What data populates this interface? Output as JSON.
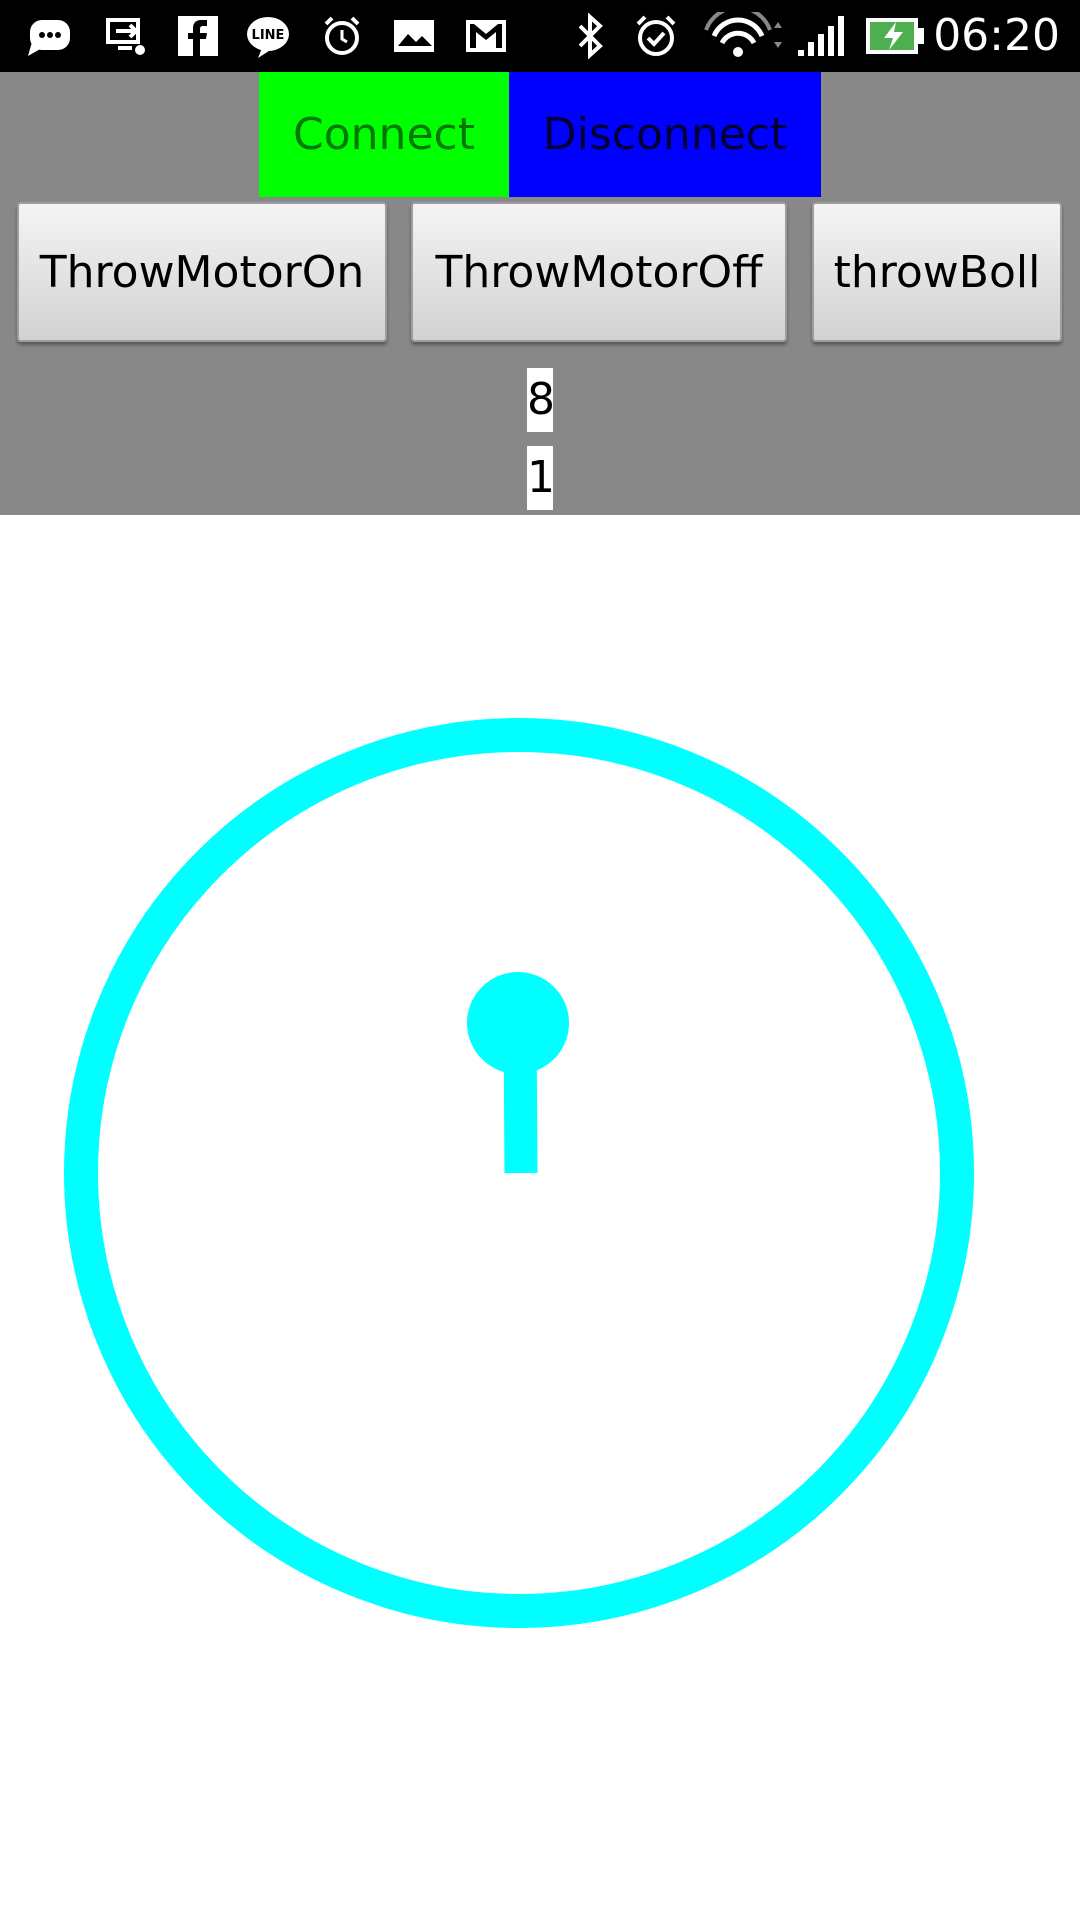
{
  "status_bar": {
    "time": "06:20",
    "icons": [
      "chat-bubble-icon",
      "screen-cast-icon",
      "facebook-icon",
      "line-icon",
      "alarm-clock-icon",
      "photo-icon",
      "gmail-icon",
      "bluetooth-icon",
      "alarm-check-icon",
      "wifi-icon",
      "signal-icon",
      "battery-charging-icon"
    ],
    "background": "#000000"
  },
  "controls": {
    "connect_label": "Connect",
    "disconnect_label": "Disconnect",
    "connect_color": "#00ff00",
    "disconnect_color": "#0000ff",
    "panel_color": "#888888"
  },
  "motor_buttons": {
    "on_label": "ThrowMotorOn",
    "off_label": "ThrowMotorOff",
    "ball_label": "throwBoll"
  },
  "readouts": {
    "value_1": "8",
    "value_2": "1"
  },
  "joystick": {
    "color": "#00ffff"
  }
}
